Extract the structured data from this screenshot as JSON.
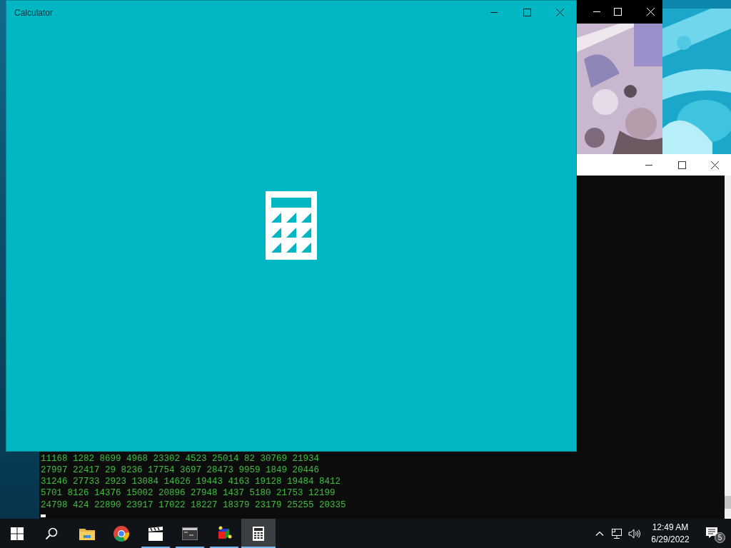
{
  "calculator_window": {
    "title": "Calculator"
  },
  "console_window": {
    "lines": [
      "11168 1282 8699 4968 23302 4523 25014 82 30769 21934",
      "27997 22417 29 8236 17754 3697 28473 9959 1849 20446",
      "31246 27733 2923 13084 14626 19443 4163 19128 19484 8412",
      "5701 8126 14376 15002 20896 27948 1437 5180 21753 12199",
      "24798 424 22890 23917 17022 18227 18379 23179 25255 20335"
    ]
  },
  "taskbar": {
    "items": [
      {
        "kind": "start",
        "running": false,
        "selected": false
      },
      {
        "kind": "search",
        "running": false,
        "selected": false
      },
      {
        "kind": "folder",
        "running": false,
        "selected": false
      },
      {
        "kind": "chrome",
        "running": false,
        "selected": false
      },
      {
        "kind": "clapper",
        "running": true,
        "selected": false
      },
      {
        "kind": "console",
        "running": true,
        "selected": false
      },
      {
        "kind": "shapes",
        "running": true,
        "selected": false
      },
      {
        "kind": "calculator",
        "running": true,
        "selected": true
      }
    ],
    "clock": {
      "time": "12:49 AM",
      "date": "6/29/2022"
    },
    "notifications": {
      "count": "5"
    }
  }
}
